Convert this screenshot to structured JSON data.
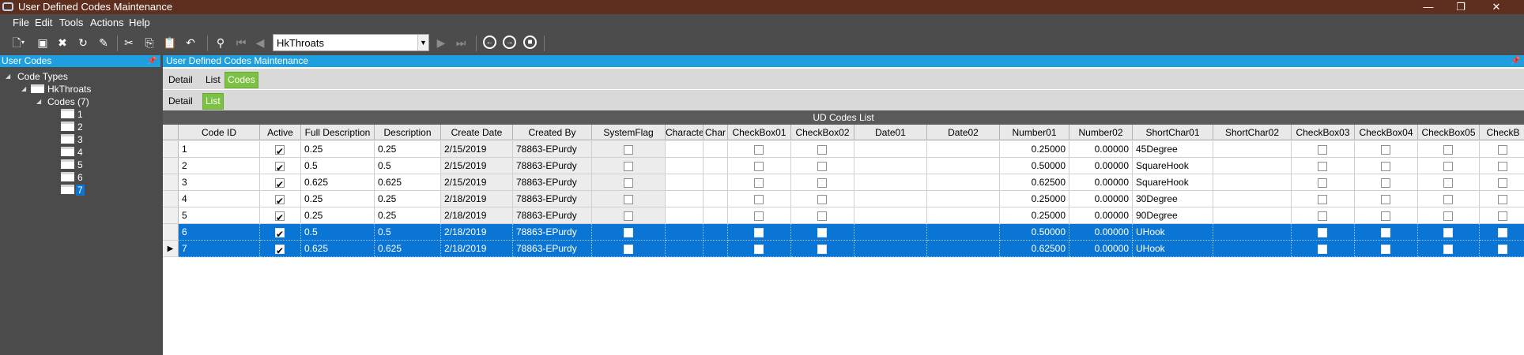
{
  "window": {
    "title": "User Defined Codes Maintenance",
    "controls": [
      "—",
      "❐",
      "✕"
    ]
  },
  "menu": [
    "File",
    "Edit",
    "Tools",
    "Actions",
    "Help"
  ],
  "toolbar": {
    "combo_value": "HkThroats",
    "icons": [
      "new-icon",
      "save-icon",
      "delete-icon",
      "refresh-icon",
      "clear-icon",
      "cut-icon",
      "copy-icon",
      "paste-icon",
      "undo-icon",
      "search-icon",
      "first-record-icon",
      "previous-record-icon",
      "next-record-icon",
      "last-record-icon",
      "back-icon",
      "forward-icon",
      "stop-icon"
    ]
  },
  "left_panel": {
    "title": "User Codes",
    "tree": {
      "root": "Code Types",
      "type": "HkThroats",
      "codes_label": "Codes (7)",
      "codes": [
        "1",
        "2",
        "3",
        "4",
        "5",
        "6",
        "7"
      ],
      "selected_code": "7"
    }
  },
  "right_panel": {
    "title": "User Defined Codes Maintenance",
    "tabs_top": [
      "Detail",
      "List",
      "Codes"
    ],
    "tabs_top_active": "Codes",
    "tabs_sub": [
      "Detail",
      "List"
    ],
    "tabs_sub_active": "List"
  },
  "grid": {
    "caption": "UD Codes List",
    "columns": [
      "Code ID",
      "Active",
      "Full Description",
      "Description",
      "Create Date",
      "Created By",
      "SystemFlag",
      "Character",
      "Char",
      "CheckBox01",
      "CheckBox02",
      "Date01",
      "Date02",
      "Number01",
      "Number02",
      "ShortChar01",
      "ShortChar02",
      "CheckBox03",
      "CheckBox04",
      "CheckBox05",
      "CheckB"
    ],
    "rows": [
      {
        "code_id": "1",
        "active": true,
        "full_desc": "0.25",
        "desc": "0.25",
        "create_date": "2/15/2019",
        "created_by": "78863-EPurdy",
        "number01": "0.25000",
        "number02": "0.00000",
        "shortchar01": "45Degree",
        "selected": false
      },
      {
        "code_id": "2",
        "active": true,
        "full_desc": "0.5",
        "desc": "0.5",
        "create_date": "2/15/2019",
        "created_by": "78863-EPurdy",
        "number01": "0.50000",
        "number02": "0.00000",
        "shortchar01": "SquareHook",
        "selected": false
      },
      {
        "code_id": "3",
        "active": true,
        "full_desc": "0.625",
        "desc": "0.625",
        "create_date": "2/15/2019",
        "created_by": "78863-EPurdy",
        "number01": "0.62500",
        "number02": "0.00000",
        "shortchar01": "SquareHook",
        "selected": false
      },
      {
        "code_id": "4",
        "active": true,
        "full_desc": "0.25",
        "desc": "0.25",
        "create_date": "2/18/2019",
        "created_by": "78863-EPurdy",
        "number01": "0.25000",
        "number02": "0.00000",
        "shortchar01": "30Degree",
        "selected": false
      },
      {
        "code_id": "5",
        "active": true,
        "full_desc": "0.25",
        "desc": "0.25",
        "create_date": "2/18/2019",
        "created_by": "78863-EPurdy",
        "number01": "0.25000",
        "number02": "0.00000",
        "shortchar01": "90Degree",
        "selected": false
      },
      {
        "code_id": "6",
        "active": true,
        "full_desc": "0.5",
        "desc": "0.5",
        "create_date": "2/18/2019",
        "created_by": "78863-EPurdy",
        "number01": "0.50000",
        "number02": "0.00000",
        "shortchar01": "UHook",
        "selected": true
      },
      {
        "code_id": "7",
        "active": true,
        "full_desc": "0.625",
        "desc": "0.625",
        "create_date": "2/18/2019",
        "created_by": "78863-EPurdy",
        "number01": "0.62500",
        "number02": "0.00000",
        "shortchar01": "UHook",
        "selected": true,
        "current": true
      }
    ]
  },
  "colors": {
    "titlebar": "#5e2f1f",
    "chrome": "#4c4c4c",
    "panel_header": "#1e9fe0",
    "tab_active": "#7cc143",
    "selection": "#0b75d6"
  }
}
